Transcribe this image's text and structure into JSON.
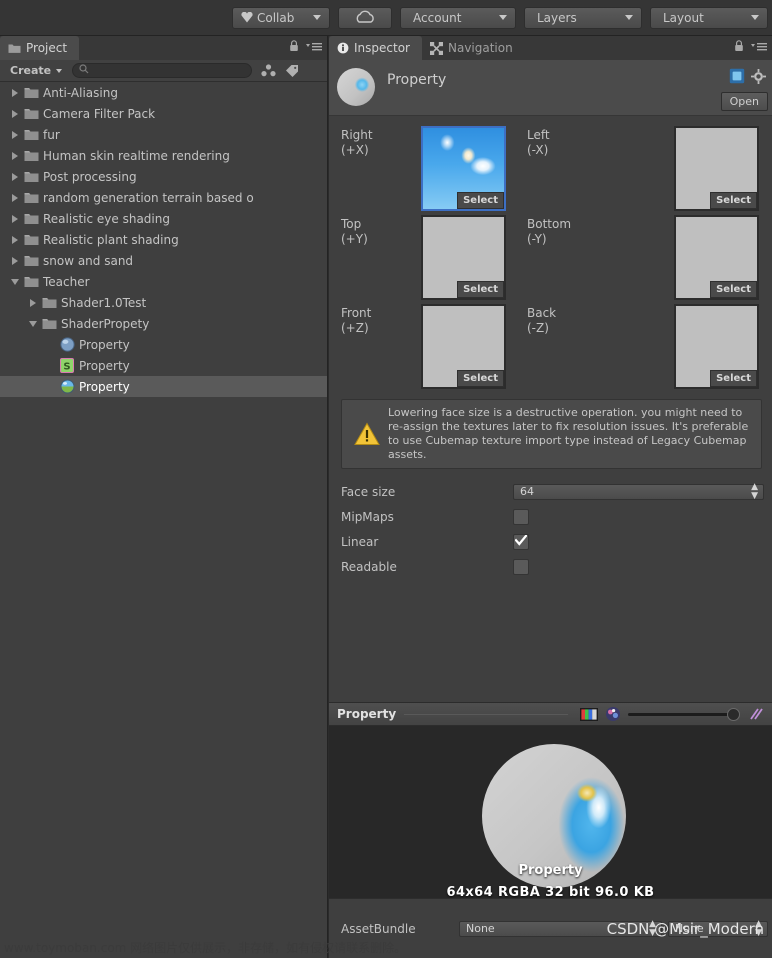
{
  "toolbar": {
    "collab_label": "Collab",
    "cloud_label": "",
    "account_label": "Account",
    "layers_label": "Layers",
    "layout_label": "Layout"
  },
  "project_panel": {
    "tab_label": "Project",
    "create_label": "Create",
    "search_value": "",
    "search_placeholder": "",
    "tree": [
      {
        "label": "Anti-Aliasing",
        "depth": 0,
        "expanded": false,
        "icon": "folder-icon",
        "selected": false
      },
      {
        "label": "Camera Filter Pack",
        "depth": 0,
        "expanded": false,
        "icon": "folder-icon",
        "selected": false
      },
      {
        "label": "fur",
        "depth": 0,
        "expanded": false,
        "icon": "folder-icon",
        "selected": false
      },
      {
        "label": "Human skin realtime rendering",
        "depth": 0,
        "expanded": false,
        "icon": "folder-icon",
        "selected": false
      },
      {
        "label": "Post processing",
        "depth": 0,
        "expanded": false,
        "icon": "folder-icon",
        "selected": false
      },
      {
        "label": "random generation terrain based o",
        "depth": 0,
        "expanded": false,
        "icon": "folder-icon",
        "selected": false
      },
      {
        "label": "Realistic eye shading",
        "depth": 0,
        "expanded": false,
        "icon": "folder-icon",
        "selected": false
      },
      {
        "label": "Realistic plant shading",
        "depth": 0,
        "expanded": false,
        "icon": "folder-icon",
        "selected": false
      },
      {
        "label": "snow and sand",
        "depth": 0,
        "expanded": false,
        "icon": "folder-icon",
        "selected": false
      },
      {
        "label": "Teacher",
        "depth": 0,
        "expanded": true,
        "icon": "folder-icon",
        "selected": false
      },
      {
        "label": "Shader1.0Test",
        "depth": 1,
        "expanded": false,
        "icon": "folder-icon",
        "selected": false
      },
      {
        "label": "ShaderPropety",
        "depth": 1,
        "expanded": true,
        "icon": "folder-icon",
        "selected": false
      },
      {
        "label": "Property",
        "depth": 2,
        "expanded": null,
        "icon": "material-icon",
        "selected": false
      },
      {
        "label": "Property",
        "depth": 2,
        "expanded": null,
        "icon": "shader-icon",
        "selected": false
      },
      {
        "label": "Property",
        "depth": 2,
        "expanded": null,
        "icon": "cubemap-icon",
        "selected": true
      }
    ]
  },
  "inspector": {
    "tabs": [
      {
        "label": "Inspector",
        "icon": "info-icon",
        "active": true
      },
      {
        "label": "Navigation",
        "icon": "navigation-icon",
        "active": false
      }
    ],
    "asset_name": "Property",
    "open_label": "Open",
    "cubemap_faces": [
      {
        "name": "Right",
        "axis": "(+X)",
        "assigned": true,
        "select_label": "Select"
      },
      {
        "name": "Left",
        "axis": "(-X)",
        "assigned": false,
        "select_label": "Select"
      },
      {
        "name": "Top",
        "axis": "(+Y)",
        "assigned": false,
        "select_label": "Select"
      },
      {
        "name": "Bottom",
        "axis": "(-Y)",
        "assigned": false,
        "select_label": "Select"
      },
      {
        "name": "Front",
        "axis": "(+Z)",
        "assigned": false,
        "select_label": "Select"
      },
      {
        "name": "Back",
        "axis": "(-Z)",
        "assigned": false,
        "select_label": "Select"
      }
    ],
    "warning": "Lowering face size is a destructive operation. you might need to re-assign the textures later to fix resolution issues. It's preferable to use Cubemap texture import type instead of Legacy Cubemap assets.",
    "properties": [
      {
        "label": "Face size",
        "type": "dropdown",
        "value": "64"
      },
      {
        "label": "MipMaps",
        "type": "checkbox",
        "value": false
      },
      {
        "label": "Linear",
        "type": "checkbox",
        "value": true
      },
      {
        "label": "Readable",
        "type": "checkbox",
        "value": false
      }
    ],
    "preview": {
      "title": "Property",
      "caption": "Property",
      "stats": "64x64  RGBA 32 bit   96.0 KB"
    },
    "assetbundle": {
      "label": "AssetBundle",
      "name_value": "None",
      "variant_value": "None"
    }
  },
  "watermarks": {
    "left": "www.toymoban.com 网络图片仅供展示，非存储，如有侵权请联系删除。",
    "right": "CSDN @Msir_Modern"
  },
  "colors": {
    "panel_bg": "#3f3f3f",
    "header_bg": "#4b4b4b",
    "toolbar_bg": "#353535",
    "selection": "#5a5a5a",
    "accent_blue": "#3d6fc4",
    "warning_yellow": "#e8c23d",
    "preview_bg": "#282828"
  }
}
